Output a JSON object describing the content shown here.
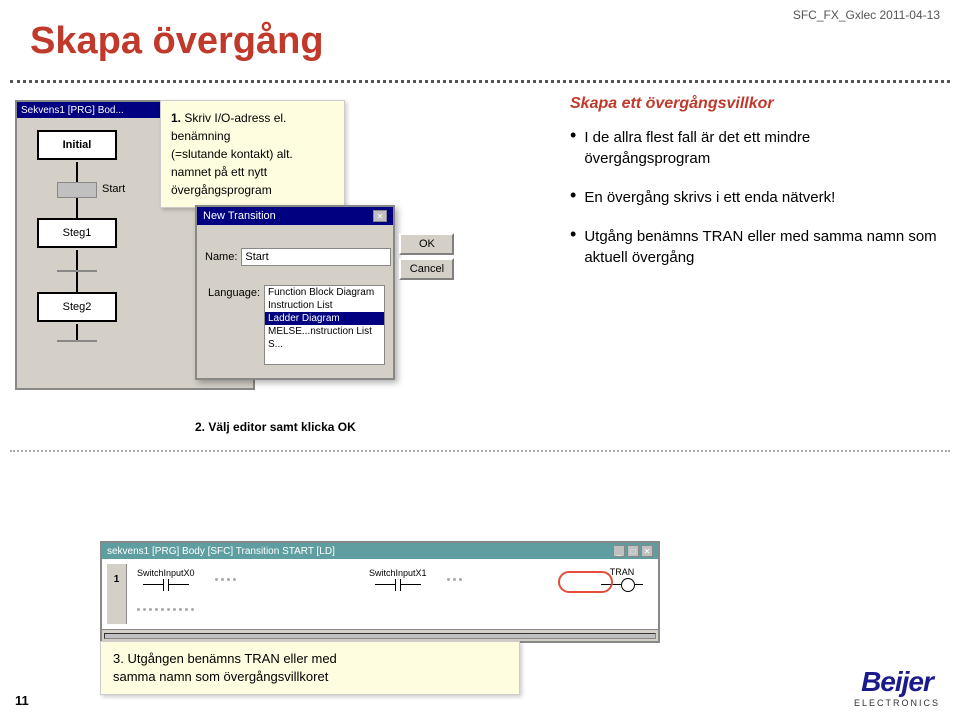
{
  "header": {
    "title": "SFC_FX_Gxlec 2011-04-13"
  },
  "page": {
    "title": "Skapa övergång",
    "number": "11"
  },
  "instructions": {
    "step1_num": "1.",
    "step1_text1": "Skriv I/O-adress el. benämning",
    "step1_text2": "(=slutande kontakt) alt.",
    "step1_text3": "namnet på ett nytt övergångsprogram",
    "step2_num": "2.",
    "step2_text": "Välj editor samt klicka OK",
    "step3_num": "3.",
    "step3_text1": "Utgången benämns TRAN eller med",
    "step3_text2": "samma namn som övergångsvillkoret"
  },
  "sfc_window": {
    "title": "Sekvens1 [PRG] Bod...",
    "initial_label": "Initial",
    "start_label": "Start",
    "steg1_label": "Steg1",
    "steg2_label": "Steg2"
  },
  "dialog": {
    "title": "New Transition",
    "name_label": "Name:",
    "name_value": "Start",
    "language_label": "Language:",
    "ok_label": "OK",
    "cancel_label": "Cancel",
    "languages": [
      "Function Block Diagram",
      "Instruction List",
      "Ladder Diagram",
      "MELSE...nstruction List",
      "S..."
    ],
    "selected_language": "Ladder Diagram"
  },
  "right_panel": {
    "title": "Skapa ett övergångsvillkor",
    "bullets": [
      "I de allra flest fall är det ett mindre övergångsprogram",
      "En övergång skrivs i ett enda nätverk!",
      "Utgång benämns TRAN eller med samma namn som aktuell övergång"
    ]
  },
  "bottom_window": {
    "title": "sekvens1 [PRG] Body [SFC] Transition START [LD]",
    "row_num": "1",
    "contact1": "SwitchInputX0",
    "contact2": "SwitchInputX1",
    "coil": "TRAN"
  }
}
